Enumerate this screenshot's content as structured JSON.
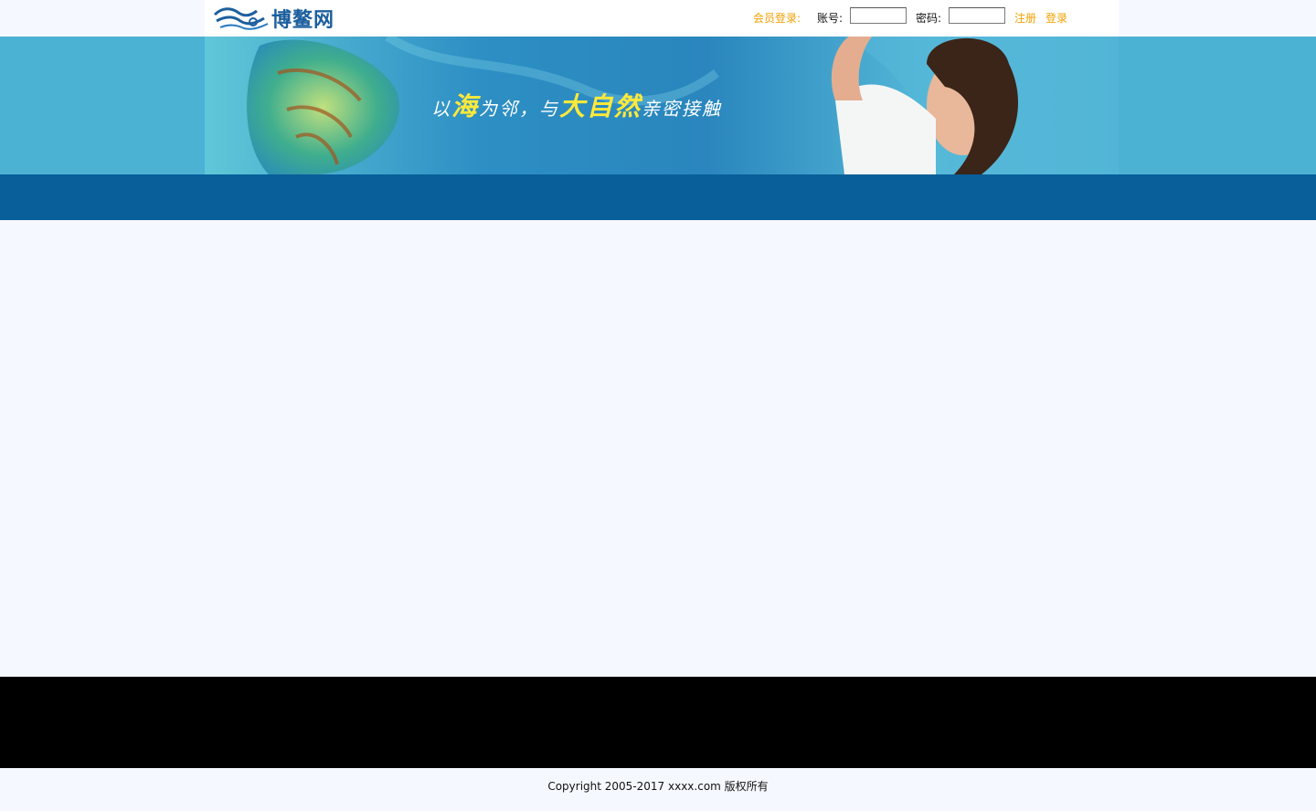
{
  "header": {
    "logo_text": "博鳌网",
    "login": {
      "title": "会员登录:",
      "account_label": "账号:",
      "account_value": "",
      "password_label": "密码:",
      "password_value": "",
      "register_label": "注册",
      "login_label": "登录"
    }
  },
  "banner": {
    "slogan_1": "以",
    "slogan_2": "海",
    "slogan_3": "为邻，与",
    "slogan_4": "大自然",
    "slogan_5": "亲密接触"
  },
  "footer": {
    "copyright": "Copyright 2005-2017 xxxx.com 版权所有"
  },
  "colors": {
    "banner_bg": "#4cb2d4",
    "nav_bg": "#085f99",
    "accent_orange": "#f2a000",
    "logo_blue": "#1c5f9e"
  }
}
